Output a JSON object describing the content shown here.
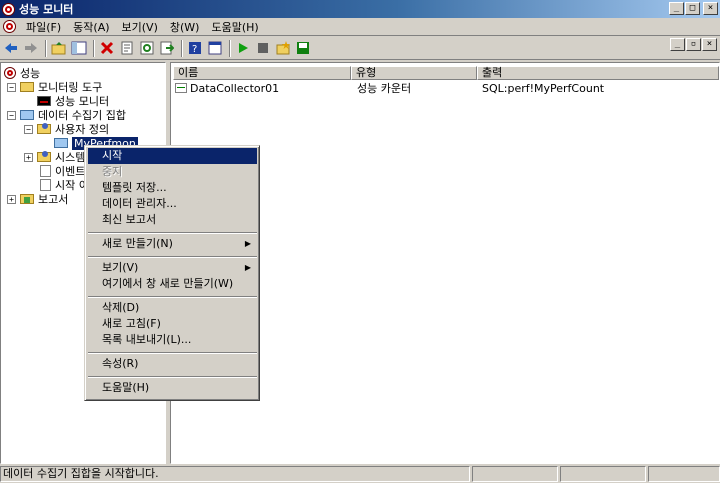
{
  "window": {
    "title": "성능 모니터",
    "controls": [
      "_",
      "□",
      "×"
    ],
    "child_controls": [
      "_",
      "▫",
      "×"
    ]
  },
  "menubar": {
    "items": [
      "파일(F)",
      "동작(A)",
      "보기(V)",
      "창(W)",
      "도움말(H)"
    ]
  },
  "toolbar": {
    "buttons": [
      "back-icon",
      "forward-icon",
      "up-folder-icon",
      "show-hide-tree-icon",
      "delete-icon",
      "properties-icon",
      "refresh-icon",
      "export-icon",
      "help-icon",
      "console-icon",
      "start-icon",
      "stop-icon",
      "new-icon",
      "save-icon"
    ]
  },
  "tree": {
    "root": "성능",
    "monitoring_tools": "모니터링 도구",
    "perf_monitor": "성능 모니터",
    "collector_sets": "데이터 수집기 집합",
    "user_defined": "사용자 정의",
    "my_perfmon": "MyPerfmon",
    "system": "시스템",
    "event_trace": "이벤트",
    "startup_event": "시작 이",
    "reports": "보고서"
  },
  "list": {
    "columns": [
      "이름",
      "유형",
      "출력"
    ],
    "rows": [
      {
        "name": "DataCollector01",
        "type": "성능 카운터",
        "output": "SQL:perf!MyPerfCount"
      }
    ]
  },
  "context_menu": {
    "start": "시작",
    "stop": "중지",
    "save_template": "템플릿 저장...",
    "data_manager": "데이터 관리자...",
    "latest_report": "최신 보고서",
    "new": "새로 만들기(N)",
    "view": "보기(V)",
    "new_window": "여기에서 창 새로 만들기(W)",
    "delete": "삭제(D)",
    "refresh": "새로 고침(F)",
    "export_list": "목록 내보내기(L)...",
    "properties": "속성(R)",
    "help": "도움말(H)",
    "submenu_arrow": "▶"
  },
  "status": {
    "message": "데이터 수집기 집합을 시작합니다."
  },
  "colors": {
    "title_start": "#0a246a",
    "title_end": "#a6caf0",
    "highlight": "#0a246a",
    "face": "#d4d0c8"
  }
}
